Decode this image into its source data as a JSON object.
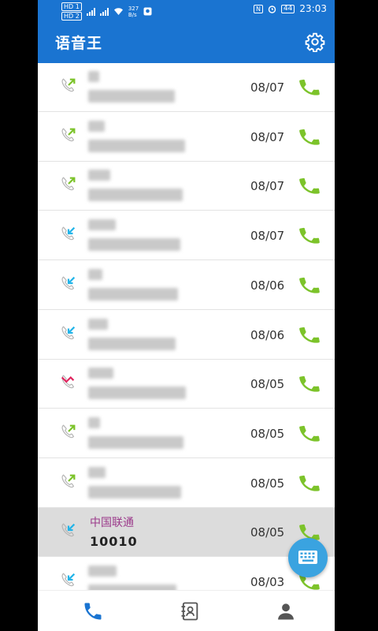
{
  "status_bar": {
    "hd_badges": [
      "HD 1",
      "HD 2"
    ],
    "speed_value": "327",
    "speed_unit": "B/s",
    "nfc_label": "N",
    "battery": "44",
    "time": "23:03"
  },
  "app_bar": {
    "title": "语音王",
    "settings_icon": "gear-icon"
  },
  "call_log": [
    {
      "type": "outgoing",
      "name": "",
      "number": "",
      "date": "08/07"
    },
    {
      "type": "outgoing",
      "name": "",
      "number": "",
      "date": "08/07"
    },
    {
      "type": "outgoing",
      "name": "",
      "number": "",
      "date": "08/07"
    },
    {
      "type": "incoming",
      "name": "",
      "number": "",
      "date": "08/07"
    },
    {
      "type": "incoming",
      "name": "",
      "number": "",
      "date": "08/06"
    },
    {
      "type": "incoming",
      "name": "",
      "number": "",
      "date": "08/06"
    },
    {
      "type": "missed",
      "name": "",
      "number": "",
      "date": "08/05"
    },
    {
      "type": "outgoing",
      "name": "",
      "number": "",
      "date": "08/05"
    },
    {
      "type": "outgoing",
      "name": "",
      "number": "",
      "date": "08/05"
    },
    {
      "type": "incoming",
      "name": "中国联通",
      "number": "10010",
      "date": "08/05",
      "selected": true
    },
    {
      "type": "incoming",
      "name": "",
      "number": "",
      "date": "08/03"
    }
  ],
  "bottom_nav": {
    "items": [
      "phone-icon",
      "contacts-book-icon",
      "person-icon"
    ],
    "active": 0
  },
  "fab_icon": "dialpad-icon",
  "colors": {
    "primary": "#1a74d1",
    "call_green": "#7cc32a",
    "incoming_blue": "#22b4e8",
    "missed_red": "#e0245e",
    "fab": "#3aa3e0"
  }
}
